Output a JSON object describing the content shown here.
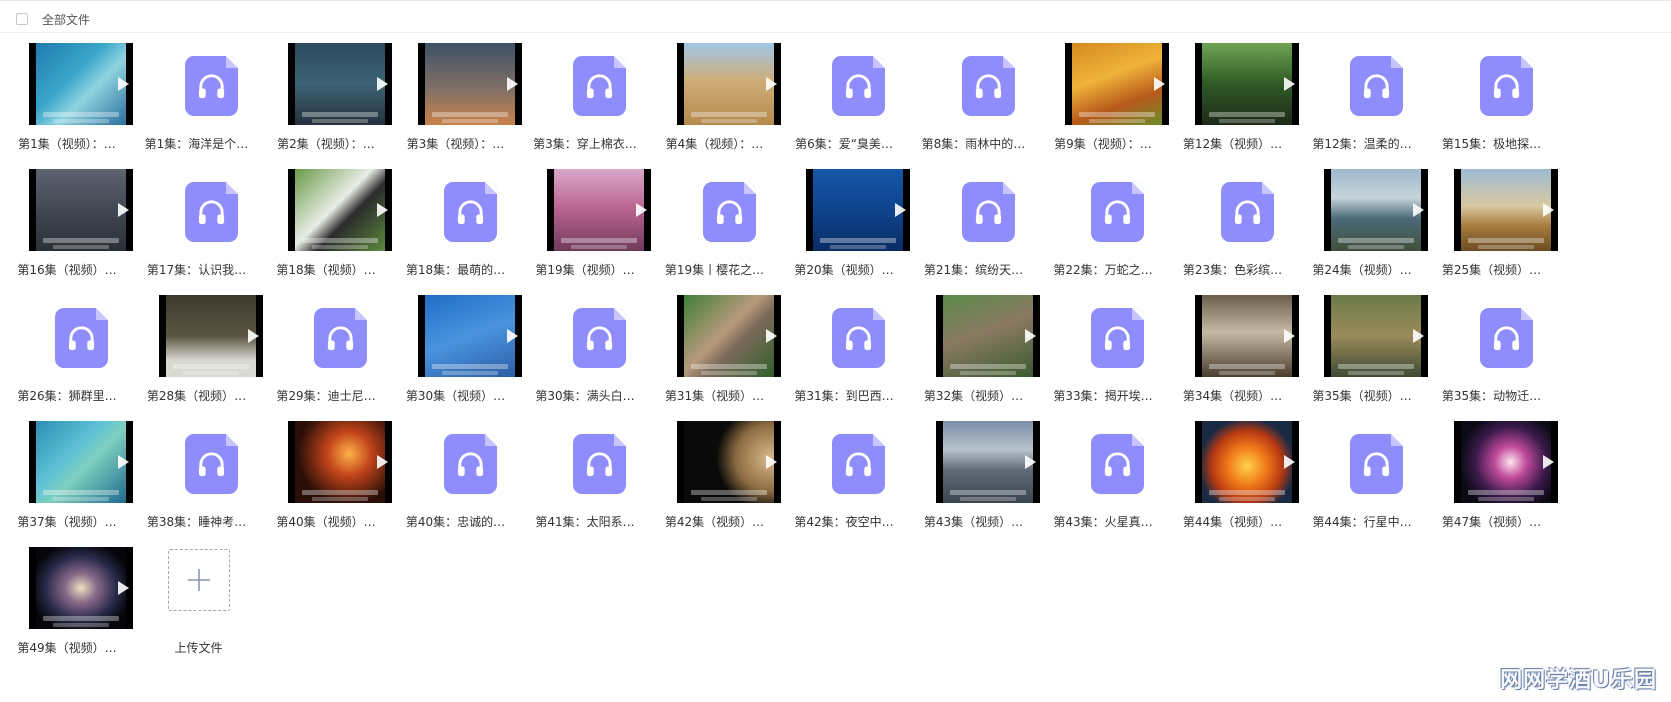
{
  "header": {
    "select_all_label": "全部文件"
  },
  "items": [
    {
      "type": "video",
      "label": "第1集（视频）：…",
      "scene": "linear-gradient(135deg,#1f7bb0,#3aa6c8 40%,#8fd3e0 60%,#2a6e9e)"
    },
    {
      "type": "audio",
      "label": "第1集：海洋是个…"
    },
    {
      "type": "video",
      "label": "第2集（视频）：…",
      "scene": "linear-gradient(180deg,#2b4a5e,#3c6275 50%,#26323d)"
    },
    {
      "type": "video",
      "label": "第3集（视频）：…",
      "scene": "linear-gradient(180deg,#3e5166,#7e6f66 55%,#c9824a)"
    },
    {
      "type": "audio",
      "label": "第3集：穿上棉衣…"
    },
    {
      "type": "video",
      "label": "第4集（视频）：…",
      "scene": "linear-gradient(180deg,#9ec7e6,#cfae7a 45%,#b5894c)"
    },
    {
      "type": "audio",
      "label": "第6集：爱“臭美…"
    },
    {
      "type": "audio",
      "label": "第8集：雨林中的…"
    },
    {
      "type": "video",
      "label": "第9集（视频）：…",
      "scene": "linear-gradient(160deg,#d48a1e,#f0b33a 40%,#b7591a 70%,#6d8b2b)"
    },
    {
      "type": "video",
      "label": "第12集（视频）…",
      "scene": "linear-gradient(180deg,#6fa353,#2f5a26 50%,#1d2a17)"
    },
    {
      "type": "audio",
      "label": "第12集：温柔的…"
    },
    {
      "type": "audio",
      "label": "第15集：极地探…"
    },
    {
      "type": "video",
      "label": "第16集（视频）…",
      "scene": "linear-gradient(180deg,#5c6470,#3b424c 60%,#2c3138)"
    },
    {
      "type": "audio",
      "label": "第17集：认识我…"
    },
    {
      "type": "video",
      "label": "第18集（视频）…",
      "scene": "linear-gradient(135deg,#6a9a48,#e8ece6 45%,#2b2b2b 60%,#5d8a3e)"
    },
    {
      "type": "audio",
      "label": "第18集：最萌的…"
    },
    {
      "type": "video",
      "label": "第19集（视频）…",
      "scene": "linear-gradient(180deg,#d9a7c8,#b9628f 50%,#6f3a5a)"
    },
    {
      "type": "audio",
      "label": "第19集丨樱花之…"
    },
    {
      "type": "video",
      "label": "第20集（视频）…",
      "scene": "linear-gradient(180deg,#1557a8,#0d3f86 60%,#0a2c63)"
    },
    {
      "type": "audio",
      "label": "第21集：缤纷天…"
    },
    {
      "type": "audio",
      "label": "第22集：万蛇之…"
    },
    {
      "type": "audio",
      "label": "第23集：色彩缤…"
    },
    {
      "type": "video",
      "label": "第24集（视频）…",
      "scene": "linear-gradient(180deg,#9fb8cc,#c8d4dc 35%,#4d6a7a 60%,#3f4f3a)"
    },
    {
      "type": "video",
      "label": "第25集（视频）…",
      "scene": "linear-gradient(180deg,#9dbbd4,#d8c9a0 45%,#a57a3c 70%,#6b4c24)"
    },
    {
      "type": "audio",
      "label": "第26集：狮群里…"
    },
    {
      "type": "video",
      "label": "第28集（视频）…",
      "scene": "linear-gradient(180deg,#3e3a2e,#5a5542 50%,#d9d9d2 80%)"
    },
    {
      "type": "audio",
      "label": "第29集：迪士尼…"
    },
    {
      "type": "video",
      "label": "第30集（视频）…",
      "scene": "linear-gradient(160deg,#1f6ec7,#4a93de 50%,#2b5ea6)"
    },
    {
      "type": "audio",
      "label": "第30集：满头白…"
    },
    {
      "type": "video",
      "label": "第31集（视频）…",
      "scene": "linear-gradient(135deg,#3f7f3a,#b89a7d 45%,#7a6a58 60%,#2e5f2a)"
    },
    {
      "type": "audio",
      "label": "第31集：到巴西…"
    },
    {
      "type": "video",
      "label": "第32集（视频）…",
      "scene": "linear-gradient(160deg,#5a8a4a,#8a7a62 45%,#3a5a2e)"
    },
    {
      "type": "audio",
      "label": "第33集：揭开埃…"
    },
    {
      "type": "video",
      "label": "第34集（视频）…",
      "scene": "linear-gradient(180deg,#6b5d4a,#c6b9a4 45%,#4a3d2e)"
    },
    {
      "type": "video",
      "label": "第35集（视频）…",
      "scene": "linear-gradient(180deg,#6d7a4a,#9a8a5a 50%,#3c4a34)"
    },
    {
      "type": "audio",
      "label": "第35集：动物迁…"
    },
    {
      "type": "video",
      "label": "第37集（视频）…",
      "scene": "linear-gradient(135deg,#2c8db5,#5fc2d6 40%,#7fd0c0 55%,#1e6a8f)"
    },
    {
      "type": "audio",
      "label": "第38集：睡神考…"
    },
    {
      "type": "video",
      "label": "第40集（视频）…",
      "scene": "radial-gradient(circle at 60% 40%,#ffb34a,#c2441a 30%,#2a0f08 70%)"
    },
    {
      "type": "audio",
      "label": "第40集：忠诚的…"
    },
    {
      "type": "audio",
      "label": "第41集：太阳系…"
    },
    {
      "type": "video",
      "label": "第42集（视频）…",
      "scene": "radial-gradient(circle at 95% 45%,#d8b98a,#8a6a40 35%,#0a0a0a 55%)"
    },
    {
      "type": "audio",
      "label": "第42集：夜空中…"
    },
    {
      "type": "video",
      "label": "第43集（视频）…",
      "scene": "linear-gradient(180deg,#7a8fa6,#b8c2cc 35%,#5e6a74 60%,#3a4550)"
    },
    {
      "type": "audio",
      "label": "第43集：火星真…"
    },
    {
      "type": "video",
      "label": "第44集（视频）…",
      "scene": "radial-gradient(circle at 50% 55%,#ffd24a,#f07a1a 30%,#b83a12 55%,#1a2a44 75%)"
    },
    {
      "type": "audio",
      "label": "第44集：行星中…"
    },
    {
      "type": "video",
      "label": "第47集（视频）…",
      "scene": "radial-gradient(circle at 55% 50%,#ffe6f0,#c04a9a 25%,#3a1a4a 55%,#0a0a14 80%)"
    },
    {
      "type": "video",
      "label": "第49集（视频）…",
      "scene": "radial-gradient(ellipse at 50% 50%,#f0e0c0,#8a6a8a 25%,#2a2a4a 55%,#05050a 80%)"
    },
    {
      "type": "upload",
      "label": "上传文件"
    }
  ],
  "watermark": "网网学酒U乐园",
  "colors": {
    "audio_icon": "#8f8cfb",
    "label_text": "#333333"
  },
  "icons": {
    "audio": "headphones-icon",
    "video": "play-icon",
    "upload": "plus-icon"
  }
}
